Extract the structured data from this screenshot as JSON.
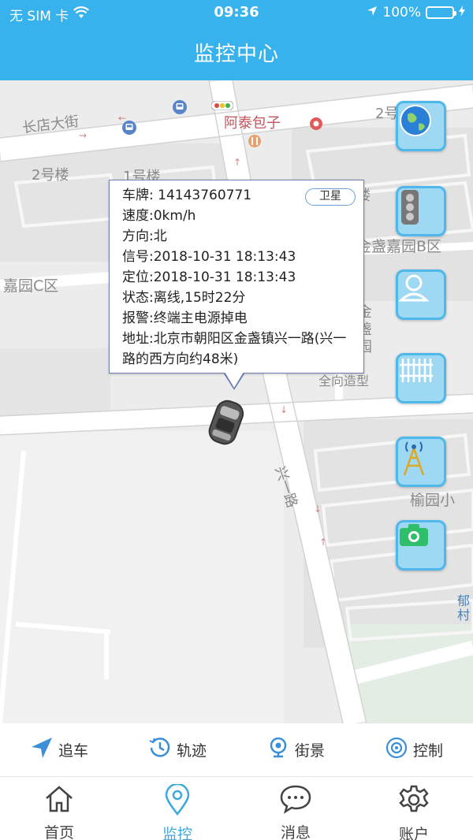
{
  "status": {
    "carrier": "无 SIM 卡",
    "time": "09:36",
    "battery": "100%",
    "battery_level": 1.0
  },
  "nav": {
    "title": "监控中心"
  },
  "map": {
    "labels": [
      {
        "name": "street-changdian",
        "text": "长店大街",
        "red": false
      },
      {
        "name": "shop-ataibaozi",
        "text": "阿泰包子",
        "red": true
      },
      {
        "name": "building-2-right",
        "text": "2号",
        "red": false
      },
      {
        "name": "building-2-left",
        "text": "2号楼",
        "red": false
      },
      {
        "name": "building-1",
        "text": "1号楼",
        "red": false
      },
      {
        "name": "jinzhan-b",
        "text": "金盏嘉园B区",
        "red": false
      },
      {
        "name": "jiayuan-c",
        "text": "嘉园C区",
        "red": false
      },
      {
        "name": "jinzhan-vertical",
        "text": "金\n盏\n园",
        "red": false
      },
      {
        "name": "jinzhan-lou",
        "text": "楼",
        "red": false
      },
      {
        "name": "quanxiang",
        "text": "全向造型",
        "red": false
      },
      {
        "name": "xingyilu",
        "text": "兴一路",
        "red": false
      },
      {
        "name": "yuyuan",
        "text": "榆园小",
        "red": false
      },
      {
        "name": "yu-cun",
        "text": "郁\n村",
        "red": false
      }
    ]
  },
  "popup": {
    "badge": "卫星",
    "plate": "车牌:  14143760771",
    "speed": "速度:0km/h",
    "direction": "方向:北",
    "signal": "信号:2018-10-31 18:13:43",
    "position": "定位:2018-10-31 18:13:43",
    "state": "状态:离线,15时22分",
    "alarm": "报警:终端主电源掉电",
    "address": "地址:北京市朝阳区金盏镇兴一路(兴一路的西方向约48米)"
  },
  "side_buttons": [
    {
      "name": "globe-button",
      "icon": "globe-icon"
    },
    {
      "name": "traffic-button",
      "icon": "traffic-light-icon"
    },
    {
      "name": "person-button",
      "icon": "person-icon"
    },
    {
      "name": "fence-button",
      "icon": "fence-icon"
    },
    {
      "name": "tower-button",
      "icon": "signal-tower-icon"
    },
    {
      "name": "camera-button",
      "icon": "camera-icon"
    }
  ],
  "actions": [
    {
      "name": "chase",
      "label": "追车",
      "icon": "navigation-arrow-icon"
    },
    {
      "name": "track",
      "label": "轨迹",
      "icon": "history-clock-icon"
    },
    {
      "name": "streetview",
      "label": "街景",
      "icon": "street-view-icon"
    },
    {
      "name": "control",
      "label": "控制",
      "icon": "target-icon"
    }
  ],
  "tabs": [
    {
      "name": "home",
      "label": "首页",
      "icon": "home-icon",
      "active": false
    },
    {
      "name": "monitor",
      "label": "监控",
      "icon": "location-pin-icon",
      "active": true
    },
    {
      "name": "messages",
      "label": "消息",
      "icon": "chat-bubble-icon",
      "active": false
    },
    {
      "name": "account",
      "label": "账户",
      "icon": "gear-icon",
      "active": false
    }
  ],
  "colors": {
    "header": "#37b2ec",
    "active_tab": "#3da7e0",
    "side_button": "#9fd8f3"
  }
}
